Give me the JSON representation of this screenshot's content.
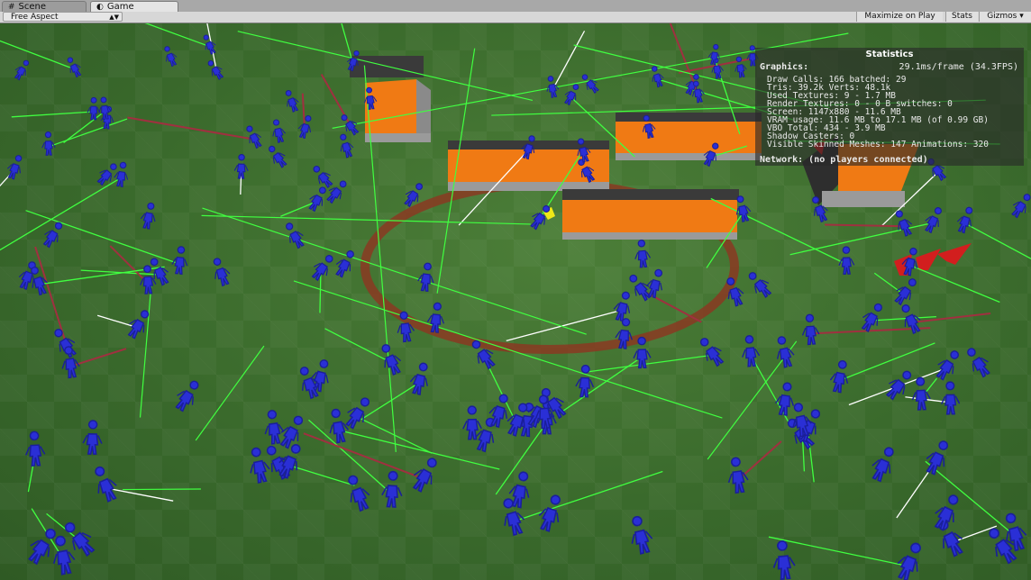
{
  "tabs": [
    {
      "label": "Scene",
      "icon": "grid-icon",
      "active": false
    },
    {
      "label": "Game",
      "icon": "pacman-icon",
      "active": true
    }
  ],
  "toolbar": {
    "aspect_value": "Free Aspect",
    "maximize_label": "Maximize on Play",
    "stats_label": "Stats",
    "gizmos_label": "Gizmos"
  },
  "stats": {
    "title": "Statistics",
    "graphics_label": "Graphics:",
    "frame_time": "29.1ms/frame (34.3FPS)",
    "lines": [
      "Draw Calls: 166   batched: 29",
      "Tris: 39.2k   Verts: 48.1k",
      "Used Textures: 9 - 1.7 MB",
      "Render Textures: 0 - 0 B   switches: 0",
      "Screen: 1147x880 - 11.6 MB",
      "VRAM usage: 11.6 MB to 17.1 MB (of 0.99 GB)",
      "VBO Total: 434 - 3.9 MB",
      "Shadow Casters: 0",
      "Visible Skinned Meshes: 147   Animations: 320"
    ],
    "network": "Network: (no players connected)"
  },
  "colors": {
    "ground": "#3c6b2d",
    "agent": "#2a2fd6",
    "wall_face": "#f07a14",
    "wall_top": "#3a3a3a",
    "ring": "#8a3a22",
    "ray_green": "#40ff40",
    "ray_white": "#ffffff",
    "ray_red": "#a03040",
    "marker_red": "#d21e1e",
    "marker_yellow": "#f0e818"
  }
}
